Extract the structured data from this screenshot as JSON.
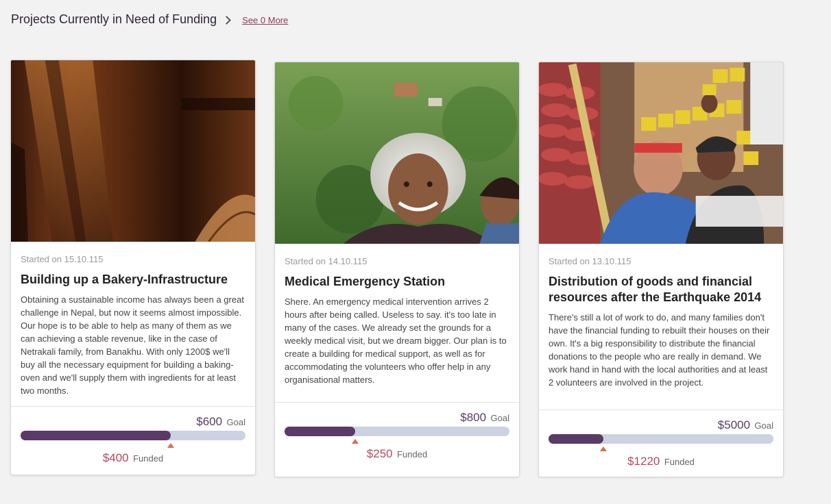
{
  "section": {
    "title": "Projects Currently in Need of Funding",
    "see_more": "See 0 More"
  },
  "projects": [
    {
      "started": "Started on 15.10.115",
      "title": "Building up a Bakery-Infrastructure",
      "description": "Obtaining a sustainable income has always been a great challenge in Nepal, but now it seems almost impossible. Our hope is to be able to help as many of them as we can achieving a stable revenue, like in the case of Netrakali family, from Banakhu. With only 1200$ we'll buy all the necessary equipment for building a baking-oven and we'll supply them with ingredients for at least two months.",
      "goal_amount": "$600",
      "goal_label": "Goal",
      "funded_amount": "$400",
      "funded_label": "Funded",
      "progress": 0.667,
      "image": "wooden-post-photo"
    },
    {
      "started": "Started on 14.10.115",
      "title": "Medical Emergency Station",
      "description": "Shere. An emergency medical intervention arrives 2 hours after being called. Useless to say. it's too late in many of the cases. We already set the grounds for a weekly medical visit, but we dream bigger. Our plan is to create a building for medical support, as well as for accommodating the volunteers who offer help in any organisational matters.",
      "goal_amount": "$800",
      "goal_label": "Goal",
      "funded_amount": "$250",
      "funded_label": "Funded",
      "progress": 0.3125,
      "image": "elderly-woman-photo"
    },
    {
      "started": "Started on 13.10.115",
      "title": "Distribution of goods and financial resources after the Earthquake 2014",
      "description": "There's still a lot of work to do, and many families don't have the financial funding to rebuilt their houses on their own. It's a big responsibility to distribute the financial donations to the people who are really in demand. We work hand in hand with the local authorities and at least 2 volunteers are involved in the project.",
      "goal_amount": "$5000",
      "goal_label": "Goal",
      "funded_amount": "$1220",
      "funded_label": "Funded",
      "progress": 0.244,
      "image": "volunteers-distribution-photo"
    }
  ],
  "colors": {
    "bar_fill": "#5a3a66",
    "bar_track": "#cdd2e2",
    "marker": "#e06a4f",
    "funded": "#b24a5d",
    "link": "#8a3b57"
  }
}
